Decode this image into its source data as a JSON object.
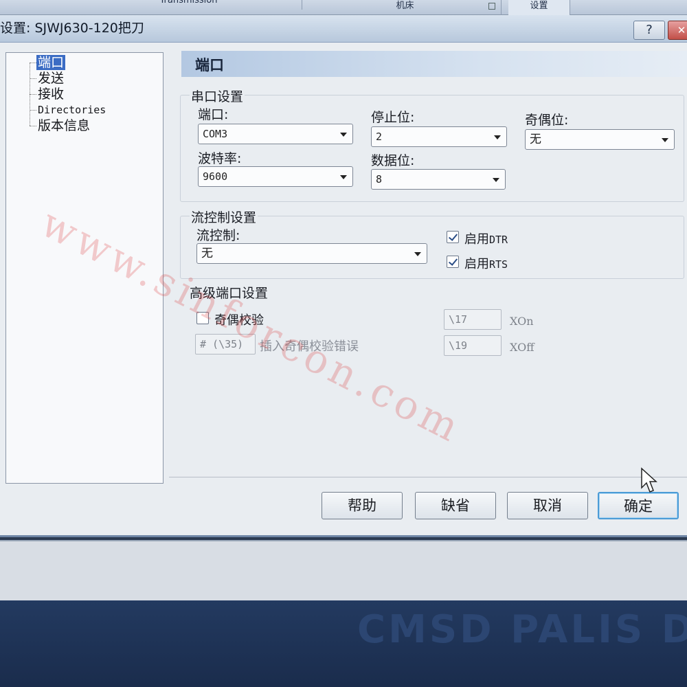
{
  "top_tabs": {
    "transmission": "Transmission",
    "machine": "机床",
    "settings": "设置"
  },
  "dialog": {
    "title": "设置: SJWJ630-120把刀",
    "help_icon_label": "?",
    "close_icon_label": "✕"
  },
  "tree": {
    "items": [
      "端口",
      "发送",
      "接收",
      "Directories",
      "版本信息"
    ],
    "selected_index": 0
  },
  "panel": {
    "header": "端口",
    "serial": {
      "group_title": "串口设置",
      "port_label": "端口:",
      "port_value": "COM3",
      "baud_label": "波特率:",
      "baud_value": "9600",
      "stop_bits_label": "停止位:",
      "stop_bits_value": "2",
      "data_bits_label": "数据位:",
      "data_bits_value": "8",
      "parity_label": "奇偶位:",
      "parity_value": "无"
    },
    "flow": {
      "group_title": "流控制设置",
      "flow_label": "流控制:",
      "flow_value": "无",
      "dtr_label_prefix": "启用",
      "dtr_label_suffix": "DTR",
      "dtr_checked": true,
      "rts_label_prefix": "启用",
      "rts_label_suffix": "RTS",
      "rts_checked": true
    },
    "advanced": {
      "group_title": "高级端口设置",
      "parity_check_label": "奇偶校验",
      "parity_check_checked": false,
      "parity_char_value": "# (\\35)",
      "insert_parity_error_label": "插入奇偶校验错误",
      "xon_value": "\\17",
      "xon_label": "XOn",
      "xoff_value": "\\19",
      "xoff_label": "XOff"
    }
  },
  "buttons": {
    "help": "帮助",
    "default": "缺省",
    "cancel": "取消",
    "ok": "确定"
  },
  "watermark": "www.sinforcon.com",
  "background_text": "CMSD PALIS D"
}
